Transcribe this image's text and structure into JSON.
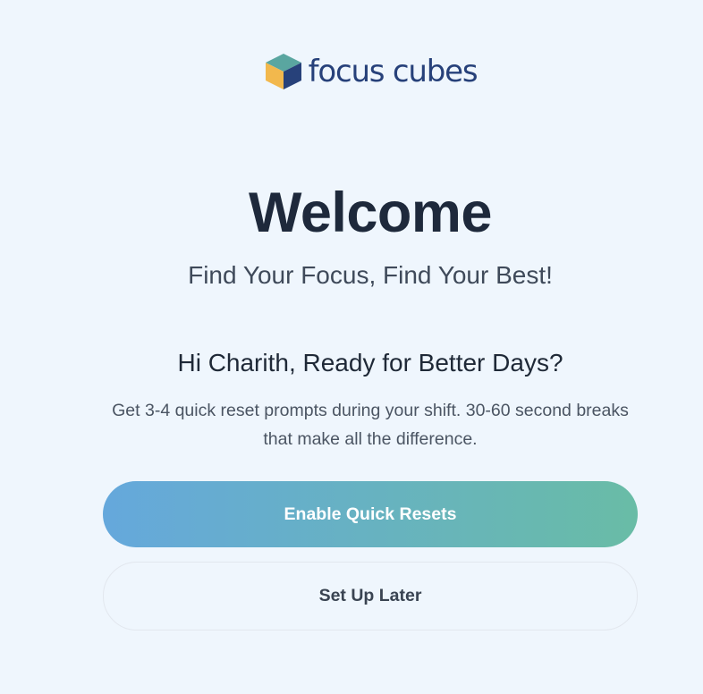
{
  "brand": {
    "name": "focus cubes",
    "icon": "cube-logo-icon",
    "colors": {
      "top": "#5aa6a0",
      "left": "#f2b84d",
      "right": "#27417a",
      "text": "#27417a"
    }
  },
  "welcome": {
    "title": "Welcome",
    "tagline": "Find Your Focus, Find Your Best!"
  },
  "prompt": {
    "greeting": "Hi Charith, Ready for Better Days?",
    "description": "Get 3-4 quick reset prompts during your shift. 30-60 second breaks that make all the difference."
  },
  "actions": {
    "primary_label": "Enable Quick Resets",
    "secondary_label": "Set Up Later",
    "primary_gradient": [
      "#65a8dc",
      "#69bca6"
    ]
  }
}
